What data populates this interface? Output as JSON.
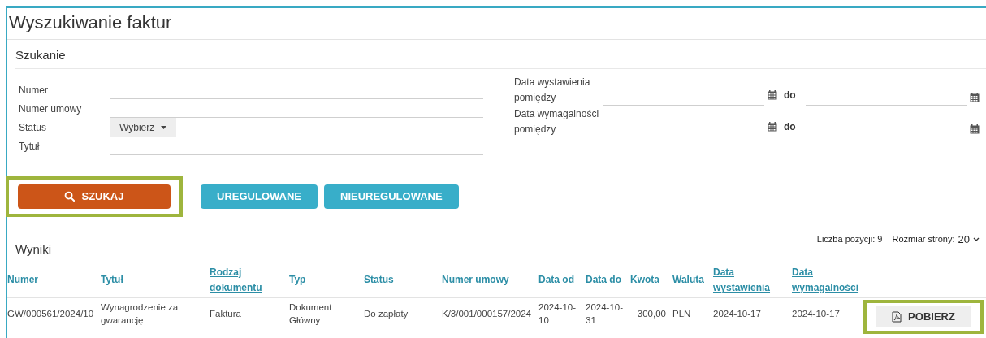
{
  "title": "Wyszukiwanie faktur",
  "search": {
    "heading": "Szukanie",
    "left_fields": [
      {
        "label": "Numer",
        "kind": "text"
      },
      {
        "label": "Numer umowy",
        "kind": "text"
      },
      {
        "label": "Status",
        "kind": "select",
        "value": "Wybierz"
      },
      {
        "label": "Tytuł",
        "kind": "text"
      }
    ],
    "date_ranges": [
      {
        "label_line1": "Data wystawienia",
        "label_line2": "pomiędzy",
        "separator": "do"
      },
      {
        "label_line1": "Data wymagalności",
        "label_line2": "pomiędzy",
        "separator": "do"
      }
    ]
  },
  "buttons": [
    {
      "label": "SZUKAJ",
      "kind": "primary",
      "highlighted": true
    },
    {
      "label": "UREGULOWANE",
      "kind": "secondary",
      "highlighted": false
    },
    {
      "label": "NIEUREGULOWANE",
      "kind": "secondary",
      "highlighted": false
    }
  ],
  "results": {
    "heading": "Wyniki",
    "count_label": "Liczba pozycji: 9",
    "page_size_label": "Rozmiar strony:",
    "page_size": "20",
    "columns": [
      {
        "label": "Numer"
      },
      {
        "label": "Tytuł"
      },
      {
        "label": "Rodzaj dokumentu"
      },
      {
        "label": "Typ"
      },
      {
        "label": "Status"
      },
      {
        "label": "Numer umowy"
      },
      {
        "label": "Data od"
      },
      {
        "label": "Data do"
      },
      {
        "label": "Kwota"
      },
      {
        "label": "Waluta"
      },
      {
        "label": "Data wystawienia"
      },
      {
        "label": "Data wymagalności"
      }
    ],
    "rows": [
      {
        "cells": [
          "GW/000561/2024/10",
          "Wynagrodzenie za gwarancję",
          "Faktura",
          "Dokument Główny",
          "Do zapłaty",
          "K/3/001/000157/2024",
          "2024-10-10",
          "2024-10-31",
          "300,00",
          "PLN",
          "2024-10-17",
          "2024-10-17"
        ],
        "action": "POBIERZ",
        "action_highlighted": true
      }
    ]
  }
}
